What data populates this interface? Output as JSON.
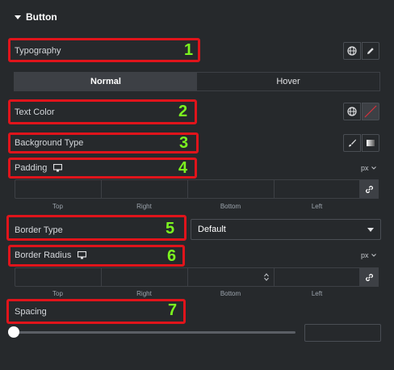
{
  "section": {
    "title": "Button"
  },
  "typography": {
    "label": "Typography",
    "number": "1"
  },
  "tabs": [
    {
      "label": "Normal"
    },
    {
      "label": "Hover"
    }
  ],
  "text_color": {
    "label": "Text Color",
    "number": "2"
  },
  "background_type": {
    "label": "Background Type",
    "number": "3"
  },
  "padding": {
    "label": "Padding",
    "number": "4",
    "unit": "px",
    "sides": [
      "Top",
      "Right",
      "Bottom",
      "Left"
    ]
  },
  "border_type": {
    "label": "Border Type",
    "number": "5",
    "value": "Default"
  },
  "border_radius": {
    "label": "Border Radius",
    "number": "6",
    "unit": "px",
    "sides": [
      "Top",
      "Right",
      "Bottom",
      "Left"
    ]
  },
  "spacing": {
    "label": "Spacing",
    "number": "7",
    "value": 0
  },
  "colors": {
    "annotation_box": "#e0141b",
    "annotation_number": "#7cf51f",
    "panel_bg": "#26292c"
  }
}
